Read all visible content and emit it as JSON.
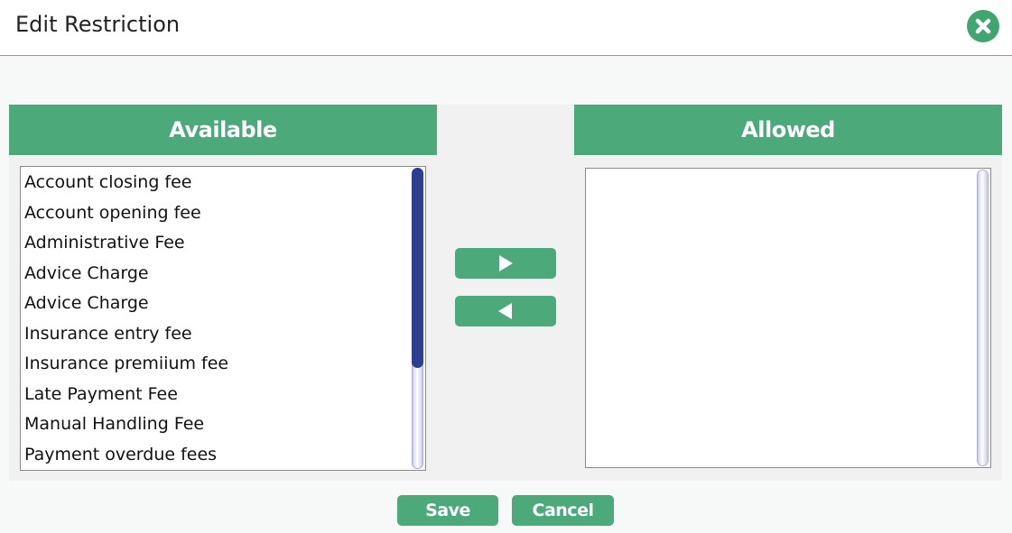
{
  "dialog": {
    "title": "Edit Restriction",
    "close_icon": "close-circle-icon"
  },
  "available": {
    "header": "Available",
    "items": [
      "Account closing fee",
      "Account opening fee",
      "Administrative Fee",
      "Advice Charge",
      "Advice Charge",
      "Insurance entry fee",
      "Insurance premiium fee",
      "Late Payment Fee",
      "Manual Handling Fee",
      "Payment overdue fees"
    ]
  },
  "allowed": {
    "header": "Allowed",
    "items": []
  },
  "controls": {
    "move_right_icon": "triangle-right-icon",
    "move_left_icon": "triangle-left-icon"
  },
  "footer": {
    "save_label": "Save",
    "cancel_label": "Cancel"
  },
  "colors": {
    "accent": "#4caa7a",
    "scroll_thumb": "#2b3e8f"
  }
}
